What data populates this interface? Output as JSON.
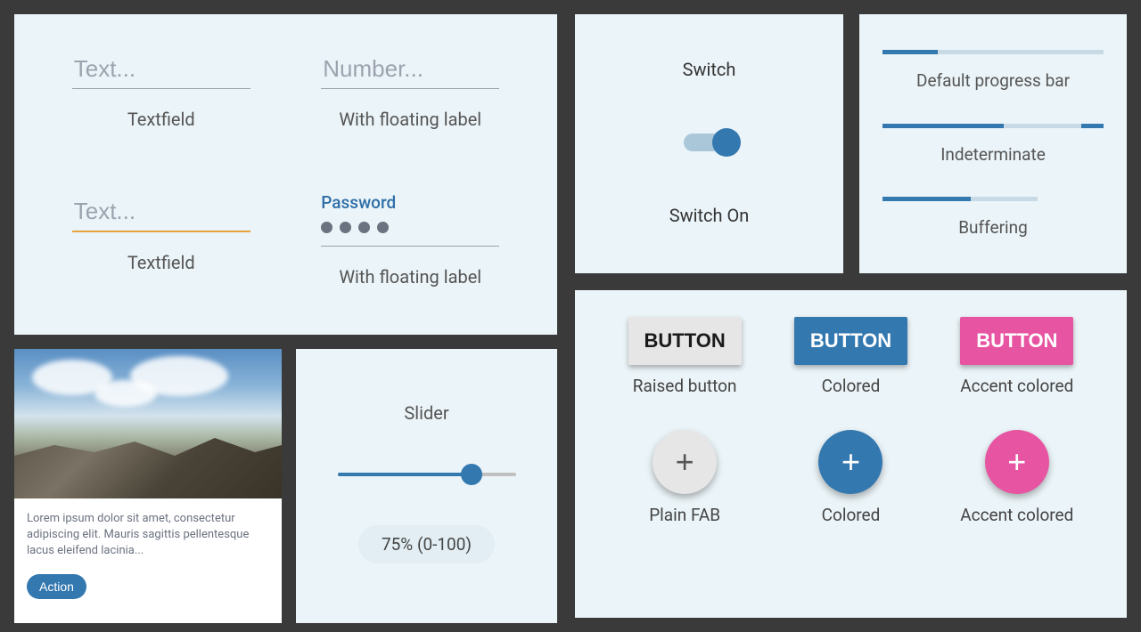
{
  "textfields": {
    "text1": {
      "placeholder": "Text...",
      "caption": "Textfield"
    },
    "number": {
      "placeholder": "Number...",
      "caption": "With floating label"
    },
    "text2": {
      "placeholder": "Text...",
      "caption": "Textfield"
    },
    "password": {
      "label": "Password",
      "caption": "With floating label",
      "dots": 4
    }
  },
  "card": {
    "text": "Lorem ipsum dolor sit amet, consectetur adipiscing elit. Mauris sagittis pellentesque lacus eleifend lacinia...",
    "action": "Action"
  },
  "slider": {
    "title": "Slider",
    "value": 75,
    "min": 0,
    "max": 100,
    "readout": "75% (0-100)"
  },
  "switch": {
    "title": "Switch",
    "on_label": "Switch On",
    "on": true
  },
  "progress": {
    "default": {
      "caption": "Default progress bar",
      "value": 25
    },
    "indeterminate": {
      "caption": "Indeterminate"
    },
    "buffering": {
      "caption": "Buffering",
      "value": 40,
      "buffer": 70
    }
  },
  "buttons": {
    "raised": {
      "plain": {
        "label": "BUTTON",
        "caption": "Raised button"
      },
      "colored": {
        "label": "BUTTON",
        "caption": "Colored"
      },
      "accent": {
        "label": "BUTTON",
        "caption": "Accent colored"
      }
    },
    "fab": {
      "plain": {
        "caption": "Plain FAB"
      },
      "colored": {
        "caption": "Colored"
      },
      "accent": {
        "caption": "Accent colored"
      }
    }
  },
  "colors": {
    "primary": "#3478b0",
    "accent": "#e754a1",
    "warn": "#e6a23c",
    "panel_bg": "#ebf4f8"
  }
}
